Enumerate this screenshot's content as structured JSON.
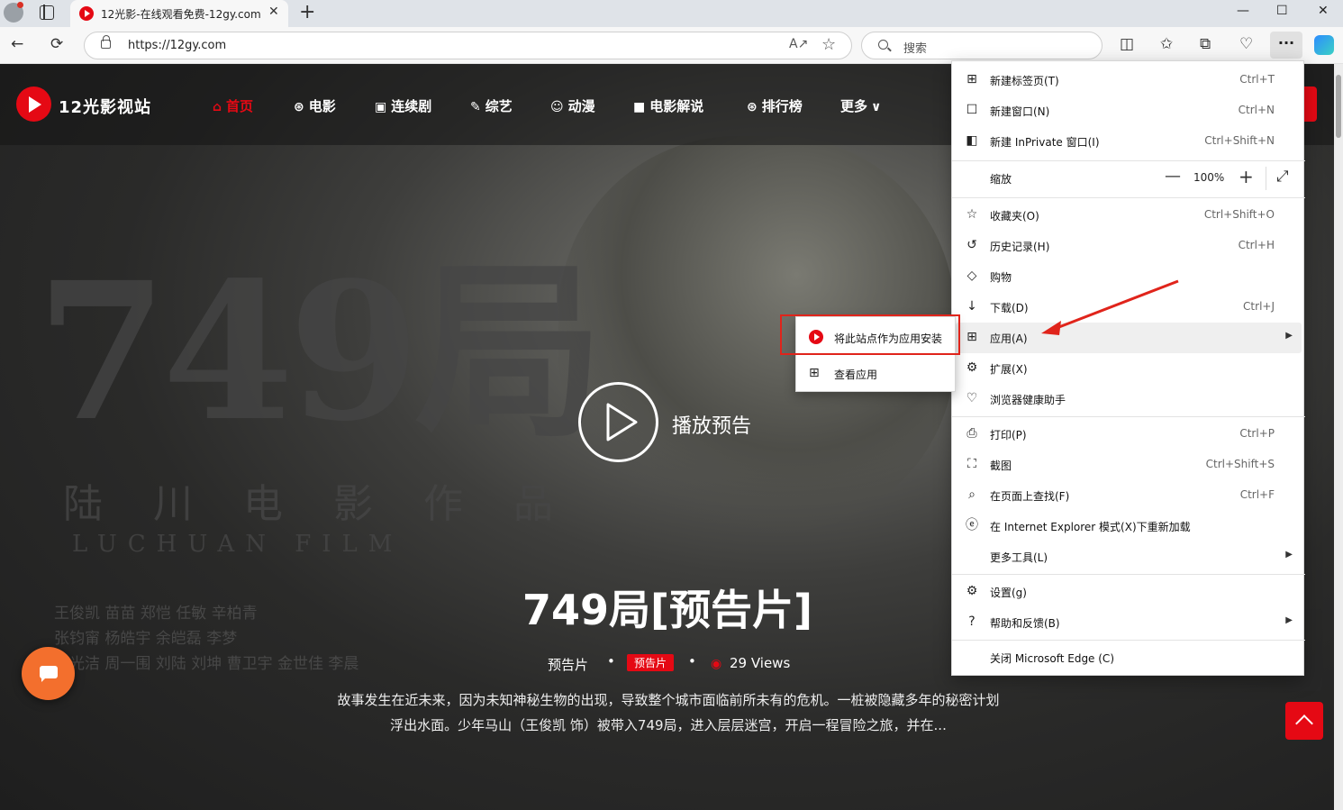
{
  "browser": {
    "tab_title": "12光影-在线观看免费-12gy.com",
    "tab_close": "✕",
    "new_tab": "+",
    "window_minimize": "—",
    "window_maximize": "☐",
    "window_close": "✕",
    "url": "https://12gy.com",
    "search_placeholder": "搜索",
    "more_button": "···"
  },
  "site": {
    "logo_text": "12光影视站",
    "nav": [
      {
        "label": "首页",
        "icon": "home-icon",
        "active": true
      },
      {
        "label": "电影",
        "icon": "film-reel-icon"
      },
      {
        "label": "连续剧",
        "icon": "tv-icon"
      },
      {
        "label": "综艺",
        "icon": "brush-icon"
      },
      {
        "label": "动漫",
        "icon": "cartoon-icon"
      },
      {
        "label": "电影解说",
        "icon": "video-camera-icon"
      },
      {
        "label": "排行榜",
        "icon": "ranking-icon"
      },
      {
        "label": "更多",
        "icon": "chevron-down-icon"
      }
    ]
  },
  "poster": {
    "big_title": "749局",
    "subtitle": "陆川电影作品",
    "english": "LUCHUAN FILM",
    "cast_line1": "王俊凯  苗苗  郑恺  任敏  辛柏青",
    "cast_line2": "张钧甯  杨皓宇  余皑磊  李梦",
    "cast_line3": "李光洁  周一围  刘陆  刘坤  曹卫宇  金世佳  李晨"
  },
  "hero": {
    "play_label": "播放预告",
    "title": "749局[预告片]",
    "category": "预告片",
    "tag": "预告片",
    "views": "29 Views",
    "dot": "•",
    "description": "故事发生在近未来，因为未知神秘生物的出现，导致整个城市面临前所未有的危机。一桩被隐藏多年的秘密计划浮出水面。少年马山（王俊凯 饰）被带入749局，进入层层迷宫，开启一程冒险之旅，并在..."
  },
  "menu": {
    "items": [
      {
        "label": "新建标签页(T)",
        "shortcut": "Ctrl+T",
        "icon": "new-tab-icon"
      },
      {
        "label": "新建窗口(N)",
        "shortcut": "Ctrl+N",
        "icon": "new-window-icon"
      },
      {
        "label": "新建 InPrivate 窗口(I)",
        "shortcut": "Ctrl+Shift+N",
        "icon": "inprivate-icon"
      },
      {
        "label": "缩放",
        "zoom": "100%"
      },
      {
        "label": "收藏夹(O)",
        "shortcut": "Ctrl+Shift+O",
        "icon": "favorites-icon"
      },
      {
        "label": "历史记录(H)",
        "shortcut": "Ctrl+H",
        "icon": "history-icon"
      },
      {
        "label": "购物",
        "shortcut": "",
        "icon": "shopping-tag-icon"
      },
      {
        "label": "下载(D)",
        "shortcut": "Ctrl+J",
        "icon": "download-icon"
      },
      {
        "label": "应用(A)",
        "shortcut": "",
        "icon": "apps-icon"
      },
      {
        "label": "扩展(X)",
        "shortcut": "",
        "icon": "extensions-icon"
      },
      {
        "label": "浏览器健康助手",
        "shortcut": "",
        "icon": "health-icon"
      },
      {
        "label": "打印(P)",
        "shortcut": "Ctrl+P",
        "icon": "print-icon"
      },
      {
        "label": "截图",
        "shortcut": "Ctrl+Shift+S",
        "icon": "screenshot-icon"
      },
      {
        "label": "在页面上查找(F)",
        "shortcut": "Ctrl+F",
        "icon": "find-icon"
      },
      {
        "label": "在 Internet Explorer 模式(X)下重新加载",
        "shortcut": "",
        "icon": "ie-icon"
      },
      {
        "label": "更多工具(L)",
        "shortcut": ""
      },
      {
        "label": "设置(g)",
        "shortcut": "",
        "icon": "gear-icon"
      },
      {
        "label": "帮助和反馈(B)",
        "shortcut": "",
        "icon": "help-icon"
      },
      {
        "label": "关闭 Microsoft Edge (C)",
        "shortcut": ""
      }
    ],
    "zoom_minus": "—",
    "zoom_plus": "+",
    "submenu": [
      {
        "label": "将此站点作为应用安装",
        "icon": "site-favicon-icon"
      },
      {
        "label": "查看应用",
        "icon": "apps-icon"
      }
    ]
  },
  "colors": {
    "brand_red": "#e50914",
    "annotation_red": "#e0241b",
    "chat_orange": "#f36f2d"
  }
}
